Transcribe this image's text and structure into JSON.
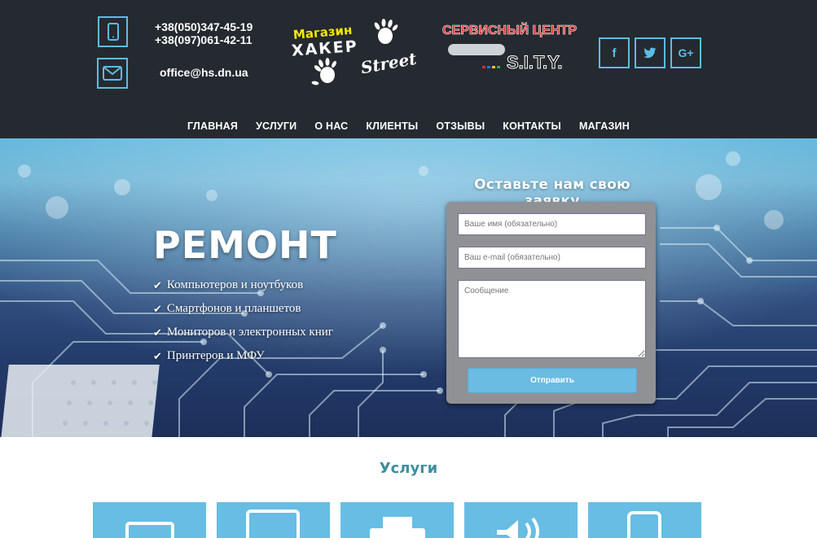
{
  "header": {
    "phones": [
      "+38(050)347-45-19",
      "+38(097)061-42-11"
    ],
    "email": "office@hs.dn.ua",
    "logo_shop": {
      "magazin": "Магазин",
      "haker": "ХАКЕР",
      "street": "Street"
    },
    "logo_service": {
      "title": "СЕРВИСНЫЙ ЦЕНТР",
      "brand": "S.I.T.Y."
    },
    "social": {
      "facebook": "f",
      "twitter": "t",
      "google": "G+"
    }
  },
  "nav": [
    "ГЛАВНАЯ",
    "УСЛУГИ",
    "О НАС",
    "КЛИЕНТЫ",
    "ОТЗЫВЫ",
    "КОНТАКТЫ",
    "МАГАЗИН"
  ],
  "hero": {
    "title": "РЕМОНТ",
    "items": [
      "Компьютеров и ноутбуков",
      "Смартфонов и планшетов",
      "Мониторов и электронных книг",
      "Принтеров и МФУ"
    ]
  },
  "form": {
    "title": "Оставьте нам свою заявку",
    "name_placeholder": "Ваше имя (обязательно)",
    "email_placeholder": "Ваш e-mail (обязательно)",
    "message_placeholder": "Сообщение",
    "submit": "Отправить"
  },
  "services": {
    "title": "Услуги",
    "icons": [
      "laptop-icon",
      "tablet-icon",
      "printer-icon",
      "speaker-icon",
      "phone-icon"
    ]
  },
  "colors": {
    "accent": "#5bbde6",
    "header_bg": "#252a30",
    "card": "#67bde3",
    "section_title": "#3f8fa0"
  }
}
